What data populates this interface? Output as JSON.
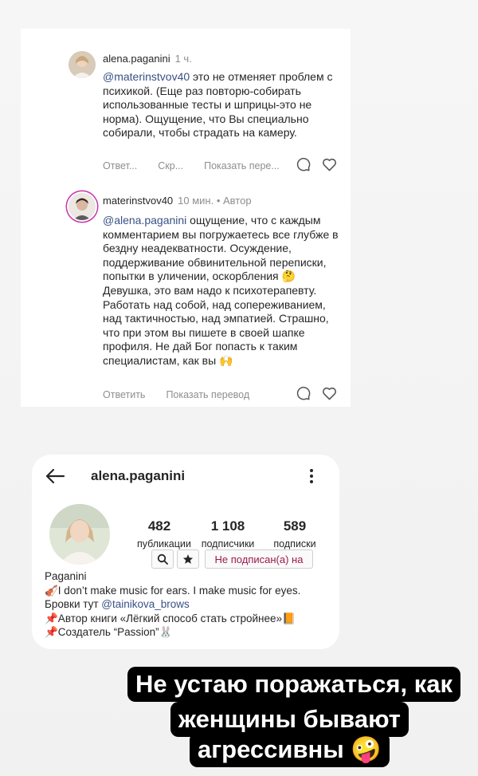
{
  "comments": [
    {
      "username": "alena.paganini",
      "meta": "1 ч.",
      "mention": "@materinstvov40",
      "text": " это не отменяет проблем с психикой. (Еще раз повторю-собирать использованные тесты и шприцы-это не норма). Ощущение, что Вы специально собирали, чтобы страдать на камеру.",
      "actions": [
        "Ответ...",
        "Скр...",
        "Показать пере..."
      ]
    },
    {
      "username": "materinstvov40",
      "meta": "10 мин. • Автор",
      "mention": "@alena.paganini",
      "text": " ощущение, что с каждым комментарием вы погружаетесь все глубже в бездну неадекватности. Осуждение, поддерживание обвинительной переписки, попытки в уличении, оскорбления 🤔 Девушка, это вам надо к психотерапевту. Работать над собой, над сопереживанием, над тактичностью, над эмпатией. Страшно, что при этом вы пишете в своей шапке профиля. Не дай Бог попасть к таким специалистам, как вы 🙌",
      "actions": [
        "Ответить",
        "Показать перевод"
      ]
    }
  ],
  "profile": {
    "username": "alena.paganini",
    "stats": [
      {
        "value": "482",
        "label": "публикации"
      },
      {
        "value": "1 108",
        "label": "подписчики"
      },
      {
        "value": "589",
        "label": "подписки"
      }
    ],
    "follow_label": "Не подписан(а) на",
    "bio": {
      "name": "Paganini",
      "line1": "🎻I don’t make music for ears. I make music for eyes.",
      "line2_prefix": "Бровки тут ",
      "line2_link": "@tainikova_brows",
      "line3": "📌Автор книги «Лёгкий способ стать стройнее»📙",
      "line4": "📌Создатель  “Passion”🐰"
    }
  },
  "caption": {
    "line1": "Не устаю поражаться, как",
    "line2": "женщины бывают",
    "line3": "агрессивны 🤪"
  },
  "icons": [
    "comment-icon",
    "heart-icon",
    "back-arrow-icon",
    "more-vertical-icon",
    "search-icon",
    "star-icon"
  ]
}
